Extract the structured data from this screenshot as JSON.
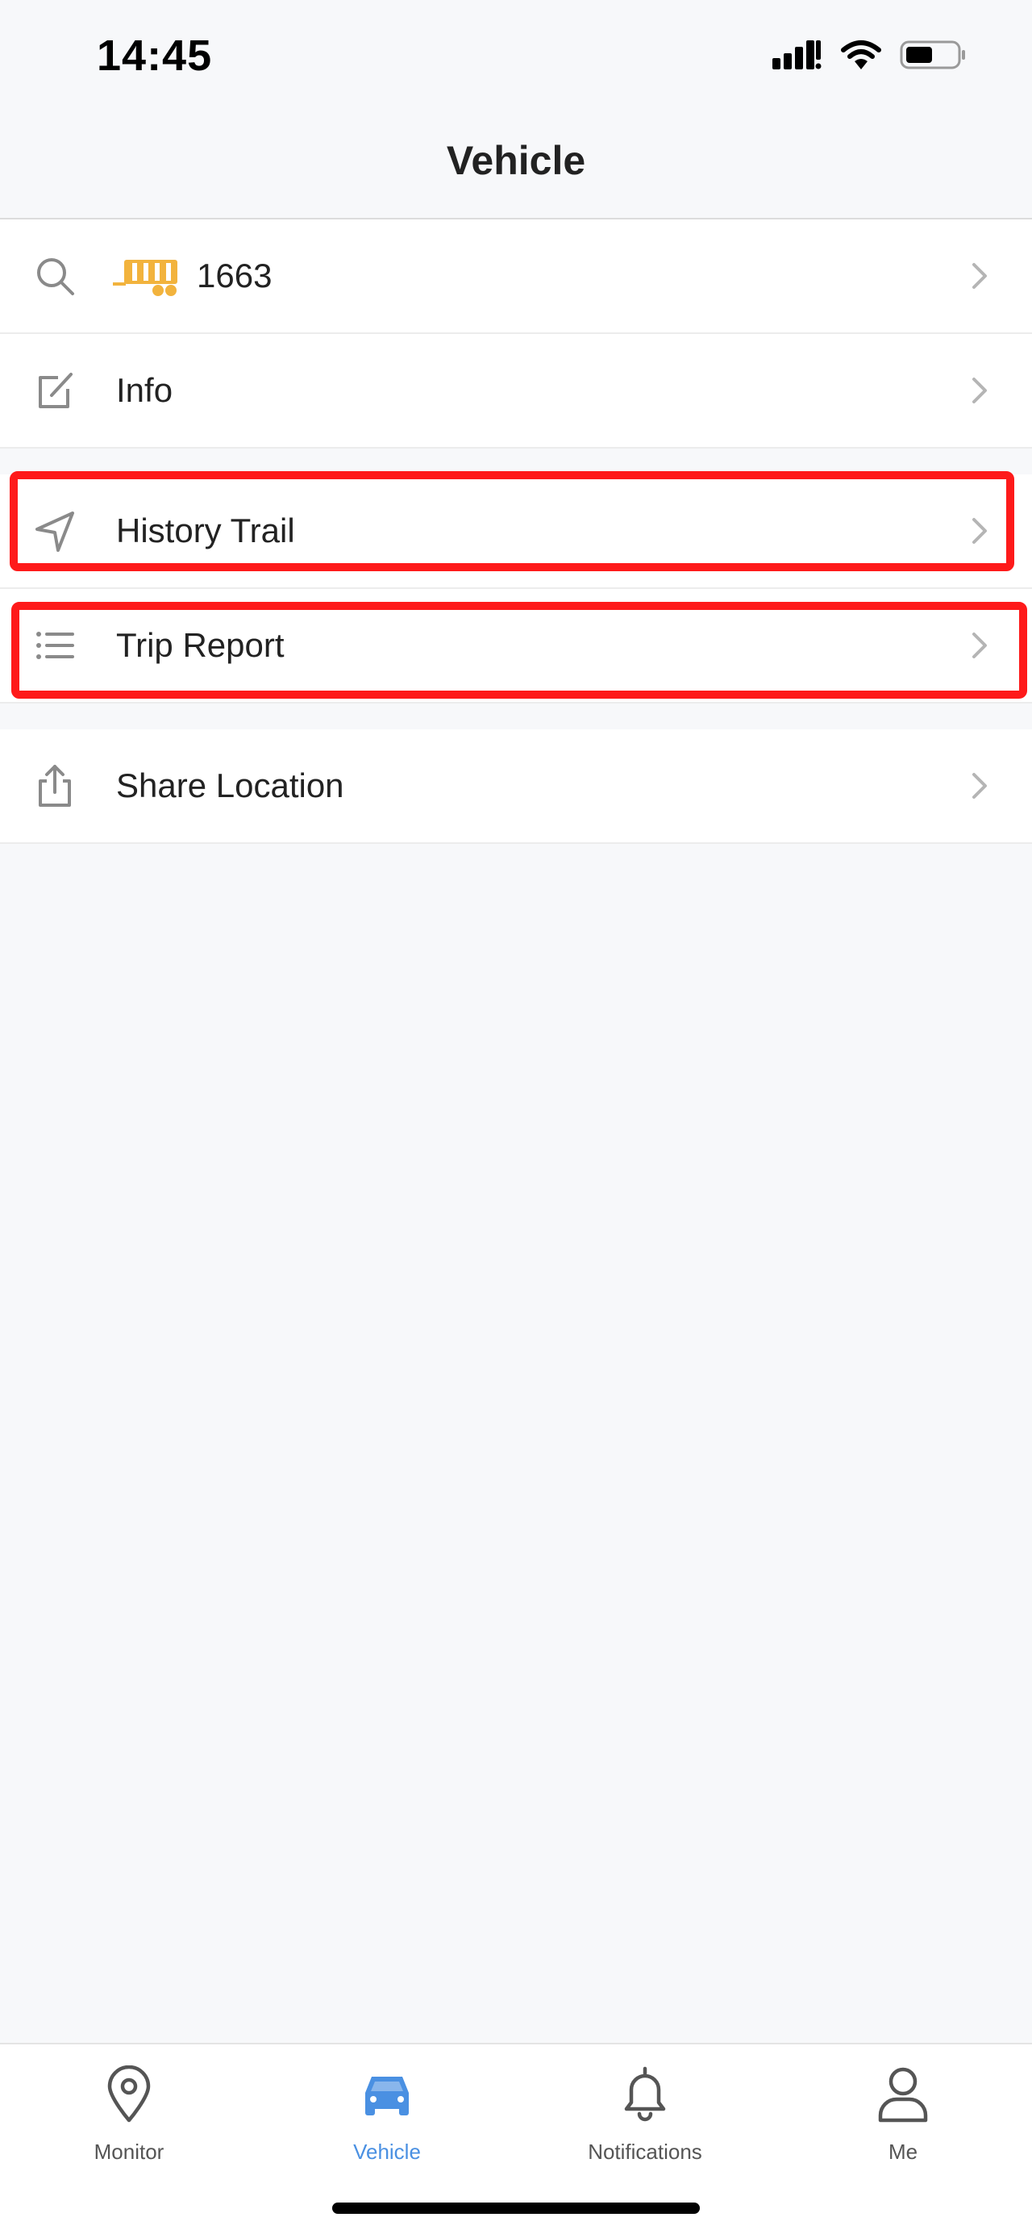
{
  "status_bar": {
    "time": "14:45",
    "icons": [
      "signal-icon",
      "wifi-icon",
      "battery-icon"
    ]
  },
  "nav": {
    "title": "Vehicle"
  },
  "menu": {
    "vehicle_row": {
      "icon": "search-icon",
      "vehicle_icon": "trailer-icon",
      "number": "1663"
    },
    "info": {
      "icon": "edit-icon",
      "label": "Info"
    },
    "history_trail": {
      "icon": "navigation-arrow-icon",
      "label": "History Trail"
    },
    "trip_report": {
      "icon": "list-icon",
      "label": "Trip Report"
    },
    "share_location": {
      "icon": "share-icon",
      "label": "Share Location"
    }
  },
  "tabs": [
    {
      "icon": "location-pin-icon",
      "label": "Monitor",
      "active": false
    },
    {
      "icon": "car-icon",
      "label": "Vehicle",
      "active": true
    },
    {
      "icon": "bell-icon",
      "label": "Notifications",
      "active": false
    },
    {
      "icon": "person-icon",
      "label": "Me",
      "active": false
    }
  ],
  "colors": {
    "background": "#f7f8fa",
    "accent": "#4a90e2",
    "highlight": "#fe1a1a",
    "trailer": "#f2b33d",
    "icon_gray": "#8a8a8a"
  }
}
